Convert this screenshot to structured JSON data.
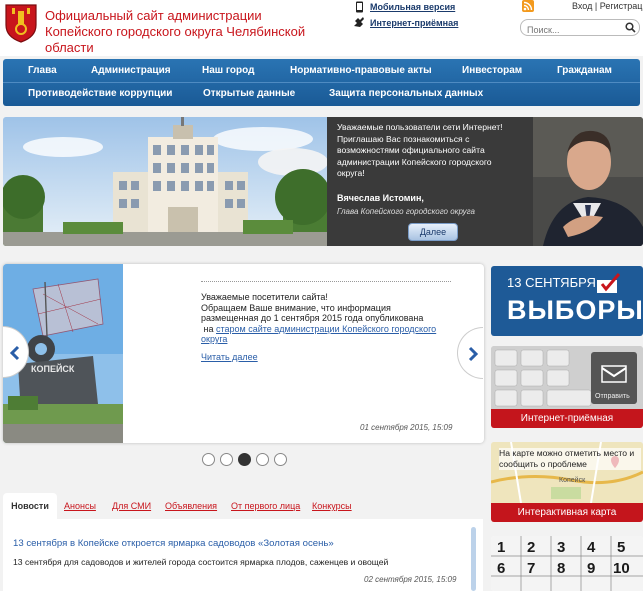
{
  "header": {
    "title_line1": "Официальный сайт администрации",
    "title_line2": "Копейского городского округа Челябинской области",
    "mobile_link": "Мобильная версия",
    "reception_link": "Интернет-приёмная",
    "login": "Вход",
    "separator": "|",
    "register": "Регистрац",
    "search_placeholder": "Поиск..."
  },
  "nav": {
    "row1": [
      "Глава",
      "Администрация",
      "Наш город",
      "Нормативно-правовые акты",
      "Инвесторам",
      "Гражданам"
    ],
    "row2": [
      "Противодействие коррупции",
      "Открытые данные",
      "Защита персональных данных"
    ]
  },
  "hero": {
    "lines": [
      "Уважаемые пользователи сети Интернет!",
      "Приглашаю Вас познакомиться с",
      "возможностями официального сайта",
      "администрации Копейского городского",
      "округа!"
    ],
    "name": "Вячеслав Истомин,",
    "position": "Глава Копейского городского округа",
    "button": "Далее"
  },
  "slider": {
    "line1": "Уважаемые посетители сайта!",
    "line2": "Обращаем Ваше внимание, что информация",
    "line3": "размещенная до 1 сентября 2015 года опубликована",
    "line4_prefix": "на",
    "link_text": "старом сайте администрации Копейского городского округа",
    "read_more": "Читать далее",
    "date": "01 сентября 2015, 15:09",
    "image_caption": "КОПЕЙСК",
    "active_dot": 3,
    "dot_count": 5
  },
  "sidebar": {
    "vybory_date": "13 СЕНТЯБРЯ",
    "vybory_title": "ВЫБОРЫ",
    "reception_label": "Интернет-приёмная",
    "reception_key": "Отправить",
    "map_text": "На карте можно отметить место и сообщить о проблеме",
    "map_city": "Копейск",
    "map_label": "Интерактивная карта"
  },
  "news": {
    "tabs": [
      "Новости",
      "Анонсы",
      "Для СМИ",
      "Объявления",
      "От первого лица",
      "Конкурсы"
    ],
    "title": "13 сентября в Копейске откроется ярмарка садоводов «Золотая осень»",
    "summary": "13 сентября для садоводов и жителей города состоится ярмарка плодов, саженцев и овощей",
    "date": "02 сентября 2015, 15:09"
  },
  "colors": {
    "brand_red": "#c8151c",
    "nav_blue": "#1f64a3",
    "link_blue": "#2a5ea8"
  }
}
